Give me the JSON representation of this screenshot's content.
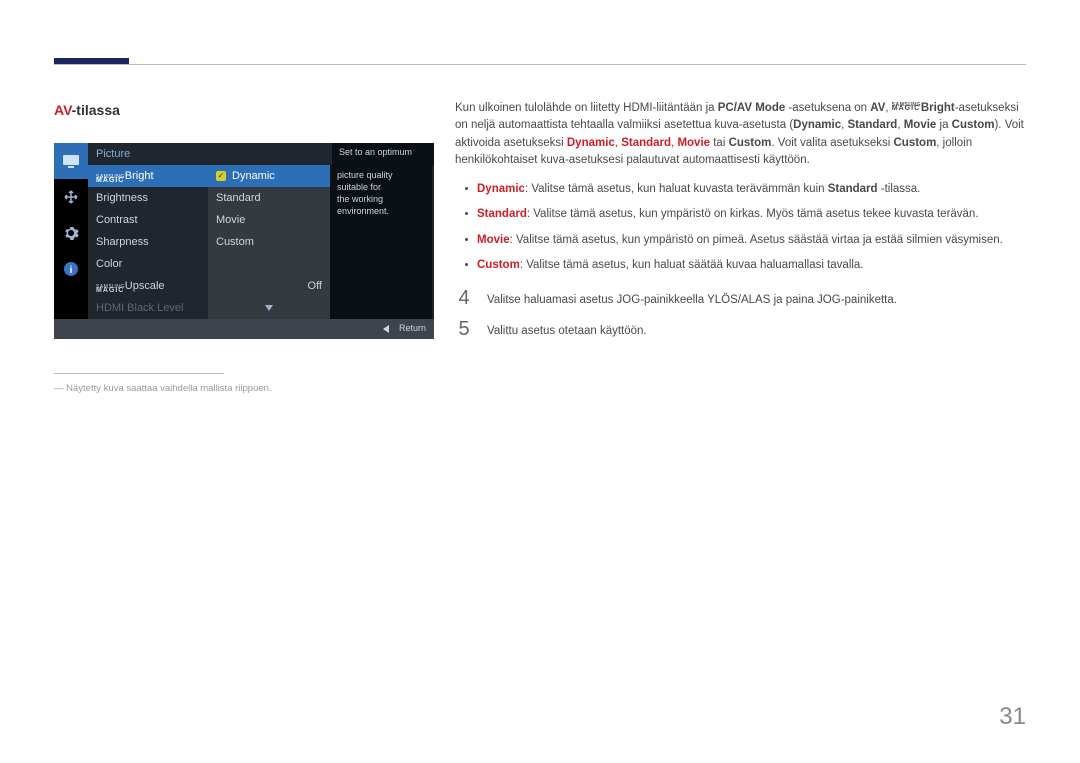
{
  "page_number": "31",
  "heading": {
    "red": "AV",
    "rest": "-tilassa"
  },
  "osd": {
    "header_title": "Picture",
    "desc_line1": "Set to an optimum",
    "desc_line2": "picture quality",
    "desc_line3": "suitable for",
    "desc_line4": "the working",
    "desc_line5": "environment.",
    "menu": {
      "magic_bright_samsung": "SAMSUNG",
      "magic_bright_magic": "MAGIC",
      "magic_bright_suffix": "Bright",
      "brightness": "Brightness",
      "contrast": "Contrast",
      "sharpness": "Sharpness",
      "color": "Color",
      "magic_upscale_samsung": "SAMSUNG",
      "magic_upscale_magic": "MAGIC",
      "magic_upscale_suffix": "Upscale",
      "magic_upscale_value": "Off",
      "hdmi_black_level": "HDMI Black Level"
    },
    "submenu": {
      "dynamic": "Dynamic",
      "standard": "Standard",
      "movie": "Movie",
      "custom": "Custom"
    },
    "footer_return": "Return"
  },
  "footnote": "Näytetty kuva saattaa vaihdella mallista riippuen.",
  "body": {
    "p1_a": "Kun ulkoinen tulolähde on liitetty HDMI-liitäntään ja ",
    "p1_pcav": "PC/AV Mode",
    "p1_b": " -asetuksena on ",
    "p1_av": "AV",
    "p1_c": ", ",
    "p1_magic_samsung": "SAMSUNG",
    "p1_magic_magic": "MAGIC",
    "p1_bright": "Bright",
    "p1_d": "-asetukseksi on neljä automaattista tehtaalla valmiiksi asetettua kuva-asetusta (",
    "p1_dynamic": "Dynamic",
    "p1_sep": ", ",
    "p1_standard": "Standard",
    "p1_movie": "Movie",
    "p1_and": " ja ",
    "p1_custom": "Custom",
    "p1_e": "). Voit aktivoida asetukseksi ",
    "p1_or": " tai ",
    "p1_f": ". Voit valita asetukseksi ",
    "p1_g": ", jolloin henkilökohtaiset kuva-asetuksesi palautuvat automaattisesti käyttöön.",
    "b1_label": "Dynamic",
    "b1_text": ": Valitse tämä asetus, kun haluat kuvasta terävämmän kuin ",
    "b1_standard": "Standard",
    "b1_tail": " -tilassa.",
    "b2_label": "Standard",
    "b2_text": ": Valitse tämä asetus, kun ympäristö on kirkas. Myös tämä asetus tekee kuvasta terävän.",
    "b3_label": "Movie",
    "b3_text": ": Valitse tämä asetus, kun ympäristö on pimeä. Asetus säästää virtaa ja estää silmien väsymisen.",
    "b4_label": "Custom",
    "b4_text": ": Valitse tämä asetus, kun haluat säätää kuvaa haluamallasi tavalla.",
    "step4_num": "4",
    "step4_text": "Valitse haluamasi asetus JOG-painikkeella YLÖS/ALAS ja paina JOG-painiketta.",
    "step5_num": "5",
    "step5_text": "Valittu asetus otetaan käyttöön."
  }
}
